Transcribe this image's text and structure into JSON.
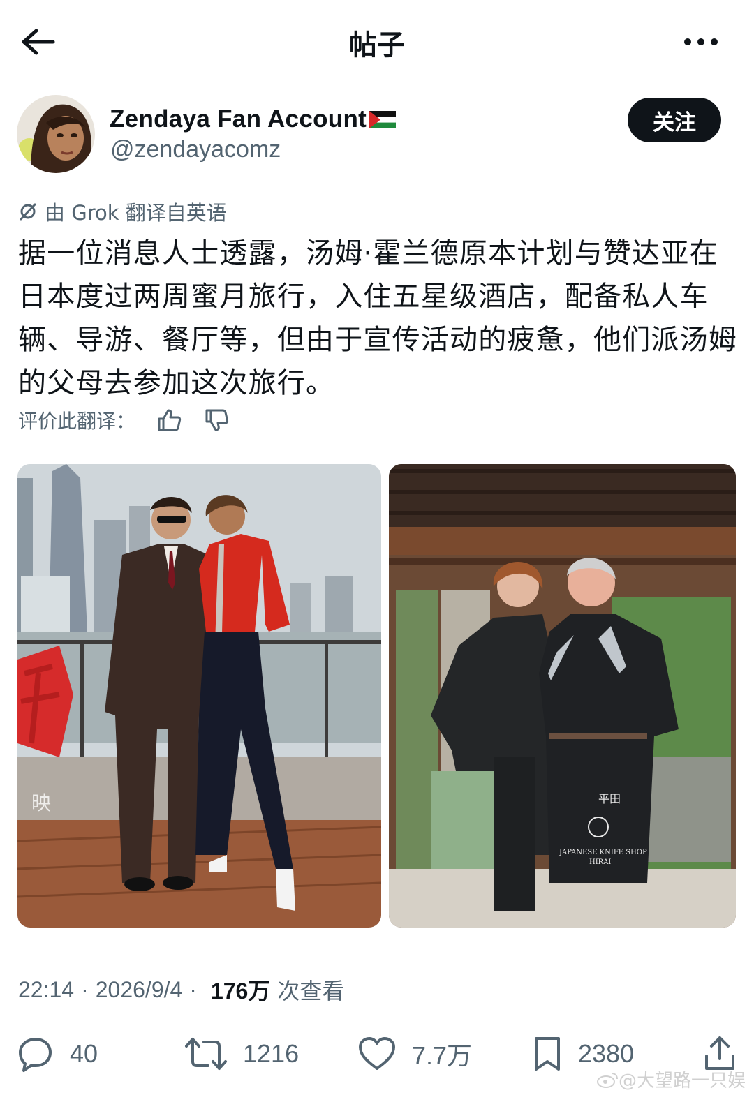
{
  "header": {
    "title": "帖子"
  },
  "author": {
    "name": "Zendaya Fan Account",
    "handle": "@zendayacomz",
    "follow_label": "关注"
  },
  "translation": {
    "notice": "由 Grok 翻译自英语",
    "rate_label": "评价此翻译："
  },
  "post": {
    "text": "据一位消息人士透露，汤姆·霍兰德原本计划与赞达亚在日本度过两周蜜月旅行，入住五星级酒店，配备私人车辆、导游、餐厅等，但由于宣传活动的疲惫，他们派汤姆的父母去参加这次旅行。"
  },
  "images": {
    "photo2_text1": "平田",
    "photo2_text2": "JAPANESE KNIFE SHOP",
    "photo2_text3": "HIRAI"
  },
  "meta": {
    "time": "22:14",
    "date": "2026/9/4",
    "views": "176万",
    "views_label": "次查看"
  },
  "actions": {
    "replies": "40",
    "reposts": "1216",
    "likes": "7.7万",
    "bookmarks": "2380"
  },
  "watermark": "@大望路一只娱",
  "colors": {
    "text": "#0f1419",
    "secondary": "#536471",
    "button": "#0f1419"
  }
}
